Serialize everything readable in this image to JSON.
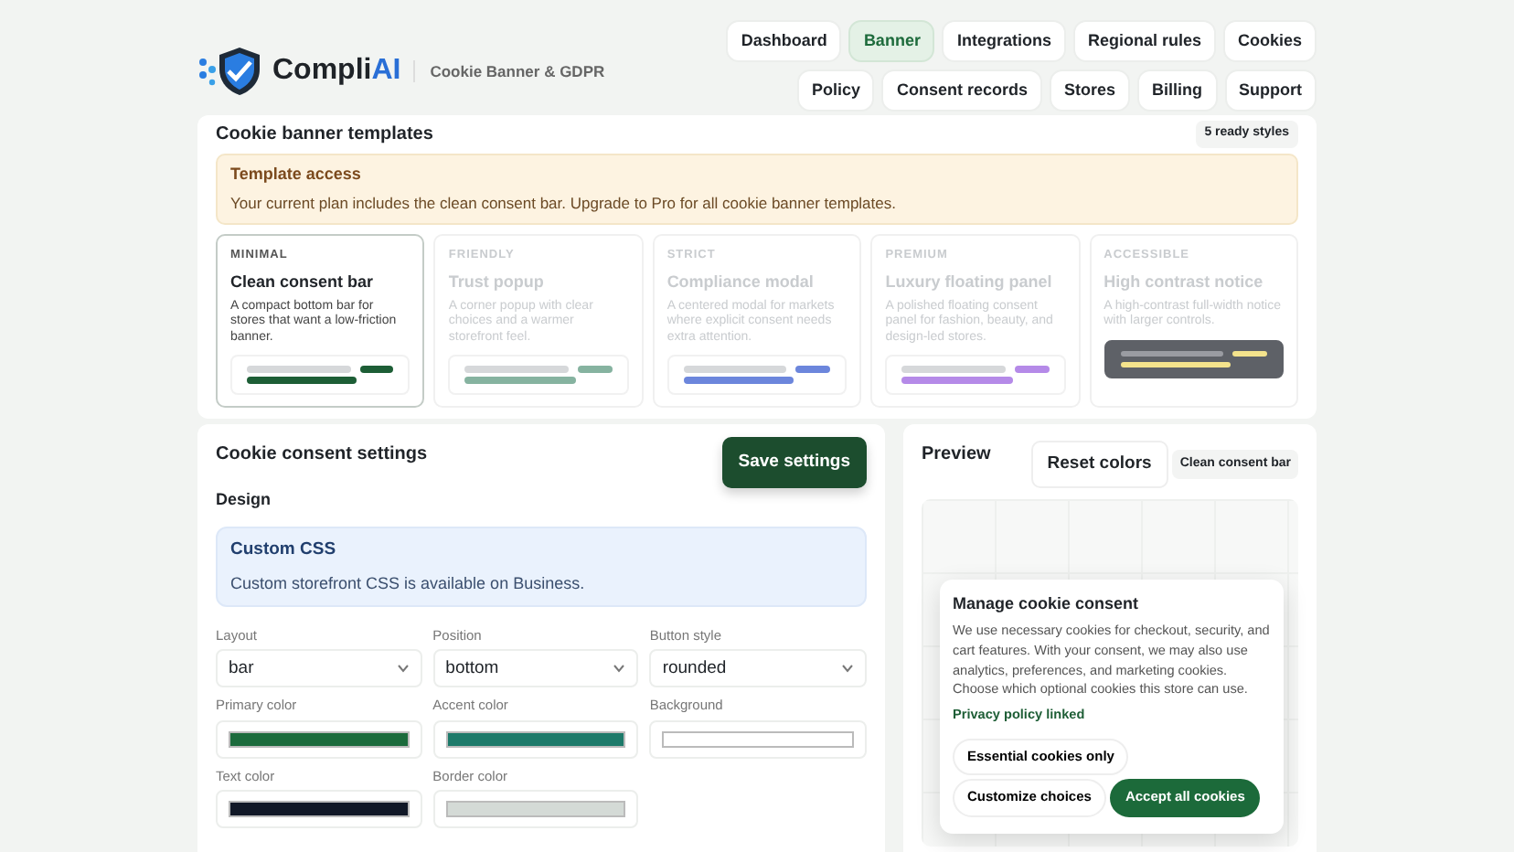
{
  "brand": {
    "name": "Compli",
    "accent": "AI",
    "subtitle": "Cookie Banner & GDPR"
  },
  "nav": [
    {
      "label": "Dashboard",
      "selected": false
    },
    {
      "label": "Banner",
      "selected": true
    },
    {
      "label": "Integrations",
      "selected": false
    },
    {
      "label": "Regional rules",
      "selected": false
    },
    {
      "label": "Cookies",
      "selected": false
    },
    {
      "label": "Policy",
      "selected": false
    },
    {
      "label": "Consent records",
      "selected": false
    },
    {
      "label": "Stores",
      "selected": false
    },
    {
      "label": "Billing",
      "selected": false
    },
    {
      "label": "Support",
      "selected": false
    }
  ],
  "templates": {
    "title": "Cookie banner templates",
    "badge": "5 ready styles",
    "notice": {
      "title": "Template access",
      "text": "Your current plan includes the clean consent bar. Upgrade to Pro for all cookie banner templates."
    },
    "items": [
      {
        "tag": "MINIMAL",
        "title": "Clean consent bar",
        "description": "A compact bottom bar for stores that want a low-friction banner.",
        "selected": true,
        "locked": false,
        "kind": "light",
        "color": "#1d5e36"
      },
      {
        "tag": "FRIENDLY",
        "title": "Trust popup",
        "description": "A corner popup with clear choices and a warmer storefront feel.",
        "selected": false,
        "locked": true,
        "kind": "light",
        "color": "#86b3a0"
      },
      {
        "tag": "STRICT",
        "title": "Compliance modal",
        "description": "A centered modal for markets where explicit consent needs extra attention.",
        "selected": false,
        "locked": true,
        "kind": "light",
        "color": "#6c86dc"
      },
      {
        "tag": "PREMIUM",
        "title": "Luxury floating panel",
        "description": "A polished floating consent panel for fashion, beauty, and design-led stores.",
        "selected": false,
        "locked": true,
        "kind": "light",
        "color": "#b58ae8"
      },
      {
        "tag": "ACCESSIBLE",
        "title": "High contrast notice",
        "description": "A high-contrast full-width notice with larger controls.",
        "selected": false,
        "locked": true,
        "kind": "dark",
        "color": "#f4e38c"
      }
    ]
  },
  "settings": {
    "title": "Cookie consent settings",
    "save": "Save settings",
    "section": "Design",
    "info": {
      "title": "Custom CSS",
      "text": "Custom storefront CSS is available on Business."
    },
    "fields": [
      {
        "kind": "select",
        "label": "Layout",
        "value": "bar"
      },
      {
        "kind": "select",
        "label": "Position",
        "value": "bottom"
      },
      {
        "kind": "select",
        "label": "Button style",
        "value": "rounded"
      },
      {
        "kind": "color",
        "label": "Primary color",
        "color": "#1b6b3c"
      },
      {
        "kind": "color",
        "label": "Accent color",
        "color": "#1d7a6a"
      },
      {
        "kind": "color",
        "label": "Background",
        "color": "#ffffff"
      },
      {
        "kind": "color",
        "label": "Text color",
        "color": "#111827"
      },
      {
        "kind": "color",
        "label": "Border color",
        "color": "#d4dad6"
      }
    ]
  },
  "preview": {
    "title": "Preview",
    "reset": "Reset colors",
    "badge": "Clean consent bar",
    "popup": {
      "title": "Manage cookie consent",
      "text": "We use necessary cookies for checkout, security, and cart features. With your consent, we may also use analytics, preferences, and marketing cookies. Choose which optional cookies this store can use.",
      "link": "Privacy policy linked",
      "buttons": [
        {
          "label": "Essential cookies only",
          "kind": "outline"
        },
        {
          "label": "Customize choices",
          "kind": "outline"
        },
        {
          "label": "Accept all cookies",
          "kind": "primary"
        }
      ]
    }
  }
}
